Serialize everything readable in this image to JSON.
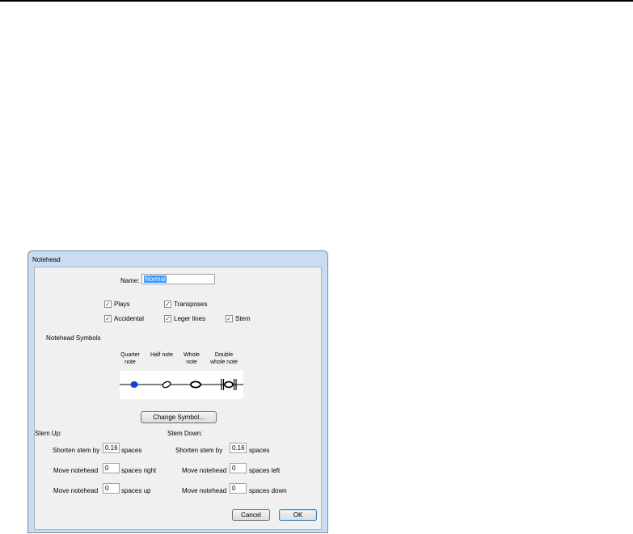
{
  "window": {
    "title": "Notehead"
  },
  "name_field": {
    "label": "Name:",
    "value": "Normal"
  },
  "options": {
    "plays": {
      "label": "Plays",
      "checked": true
    },
    "transposes": {
      "label": "Transposes",
      "checked": true
    },
    "accidental": {
      "label": "Accidental",
      "checked": true
    },
    "leger_lines": {
      "label": "Leger lines",
      "checked": true
    },
    "stem": {
      "label": "Stem",
      "checked": true
    }
  },
  "symbols": {
    "heading": "Notehead Symbols",
    "columns": [
      {
        "line1": "Quarter",
        "line2": "note"
      },
      {
        "line1": "Half note",
        "line2": ""
      },
      {
        "line1": "Whole",
        "line2": "note"
      },
      {
        "line1": "Double",
        "line2": "whole note"
      }
    ],
    "change_button": "Change Symbol...",
    "selected_color": "#1a3fd6"
  },
  "stem_up": {
    "heading": "Stem Up:",
    "shorten_label": "Shorten stem by",
    "shorten_value": "0.16",
    "shorten_unit": "spaces",
    "move_h_label": "Move notehead",
    "move_h_value": "0",
    "move_h_unit": "spaces right",
    "move_v_label": "Move notehead",
    "move_v_value": "0",
    "move_v_unit": "spaces up"
  },
  "stem_down": {
    "heading": "Stem Down:",
    "shorten_label": "Shorten stem by",
    "shorten_value": "0.16",
    "shorten_unit": "spaces",
    "move_h_label": "Move notehead",
    "move_h_value": "0",
    "move_h_unit": "spaces left",
    "move_v_label": "Move notehead",
    "move_v_value": "0",
    "move_v_unit": "spaces down"
  },
  "buttons": {
    "cancel": "Cancel",
    "ok": "OK"
  },
  "check_glyph": "✓"
}
